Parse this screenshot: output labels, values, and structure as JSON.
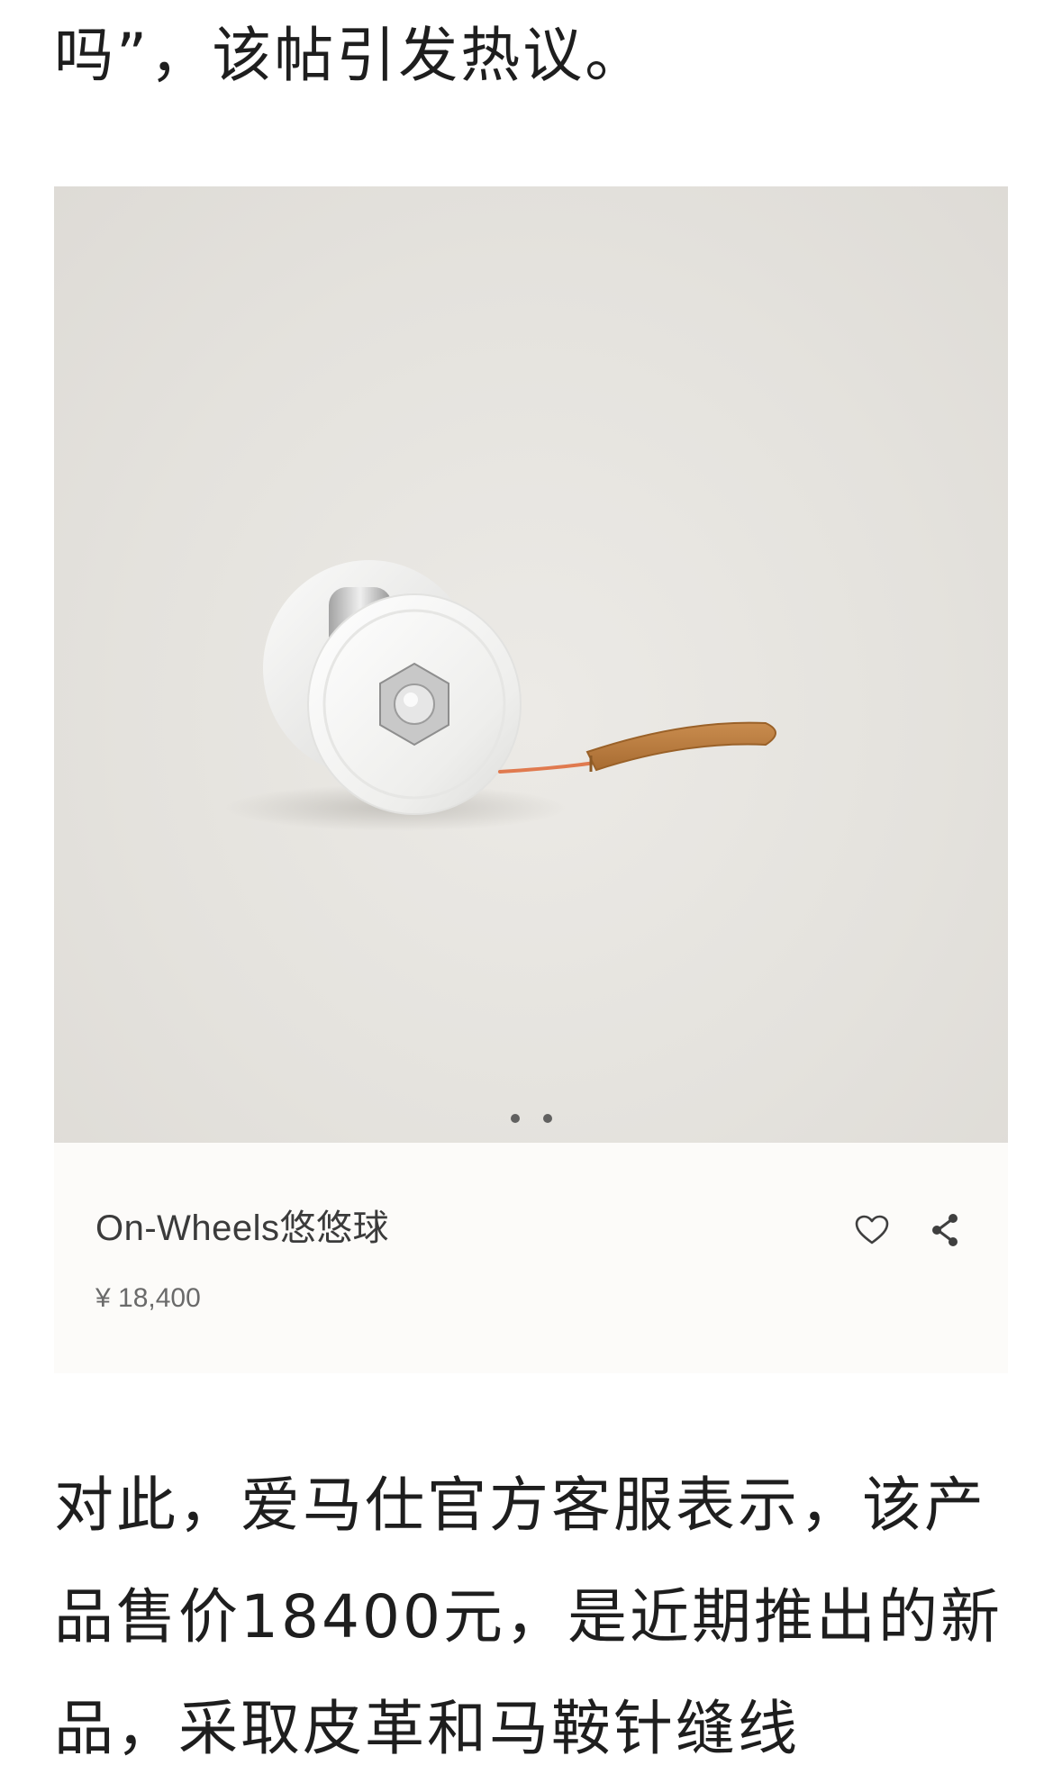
{
  "article": {
    "intro_line": "吗”，该帖引发热议。",
    "paragraph": "对此，爱马仕官方客服表示，该产品售价18400元，是近期推出的新品，采取皮革和马鞍针缝线"
  },
  "product_card": {
    "name": "On-Wheels悠悠球",
    "price": "¥ 18,400",
    "carousel": {
      "total_slides": 2,
      "active_slide": 1
    },
    "icons": {
      "favorite": "heart-outline-icon",
      "share": "share-icon"
    }
  },
  "colors": {
    "image_bg": "#e4e2dd",
    "card_bg": "#fcfbf9",
    "leather_strap": "#b77a3e",
    "cord": "#e07a4f"
  }
}
